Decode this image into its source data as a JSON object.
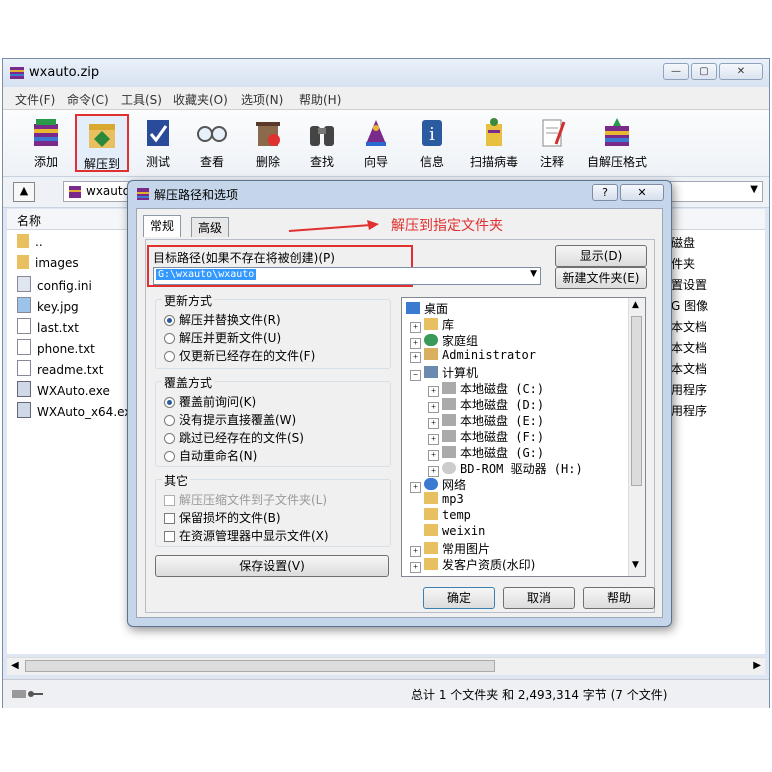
{
  "window": {
    "title": "wxauto.zip",
    "menu": [
      "文件(F)",
      "命令(C)",
      "工具(S)",
      "收藏夹(O)",
      "选项(N)",
      "帮助(H)"
    ],
    "toolbar": [
      "添加",
      "解压到",
      "测试",
      "查看",
      "删除",
      "查找",
      "向导",
      "信息",
      "扫描病毒",
      "注释",
      "自解压格式"
    ],
    "address": "wxauto",
    "column_name": "名称",
    "files": [
      "..",
      "images",
      "config.ini",
      "key.jpg",
      "last.txt",
      "phone.txt",
      "readme.txt",
      "WXAuto.exe",
      "WXAuto_x64.exe"
    ],
    "right_col": [
      "磁盘",
      "件夹",
      "置设置",
      "G 图像",
      "本文档",
      "本文档",
      "本文档",
      "用程序",
      "用程序"
    ],
    "status": "总计 1 个文件夹 和 2,493,314 字节 (7 个文件)",
    "colors": {
      "accent": "#e03030",
      "dialog_frame": "#c6d6ea",
      "selection": "#3399ff"
    }
  },
  "dialog": {
    "title": "解压路径和选项",
    "help_btn": "?",
    "tabs": [
      "常规",
      "高级"
    ],
    "annotation": "解压到指定文件夹",
    "path_label": "目标路径(如果不存在将被创建)(P)",
    "path_value": "G:\\wxauto\\wxauto",
    "show_btn": "显示(D)",
    "new_folder_btn": "新建文件夹(E)",
    "update_group": {
      "title": "更新方式",
      "options": [
        "解压并替换文件(R)",
        "解压并更新文件(U)",
        "仅更新已经存在的文件(F)"
      ]
    },
    "overwrite_group": {
      "title": "覆盖方式",
      "options": [
        "覆盖前询问(K)",
        "没有提示直接覆盖(W)",
        "跳过已经存在的文件(S)",
        "自动重命名(N)"
      ]
    },
    "other_group": {
      "title": "其它",
      "options": [
        "解压压缩文件到子文件夹(L)",
        "保留损坏的文件(B)",
        "在资源管理器中显示文件(X)"
      ]
    },
    "save_btn": "保存设置(V)",
    "tree": [
      "桌面",
      "库",
      "家庭组",
      "Administrator",
      "计算机",
      "本地磁盘 (C:)",
      "本地磁盘 (D:)",
      "本地磁盘 (E:)",
      "本地磁盘 (F:)",
      "本地磁盘 (G:)",
      "BD-ROM 驱动器 (H:)",
      "网络",
      "mp3",
      "temp",
      "weixin",
      "常用图片",
      "发客户资质(水印)"
    ],
    "ok_btn": "确定",
    "cancel_btn": "取消",
    "help2_btn": "帮助"
  }
}
